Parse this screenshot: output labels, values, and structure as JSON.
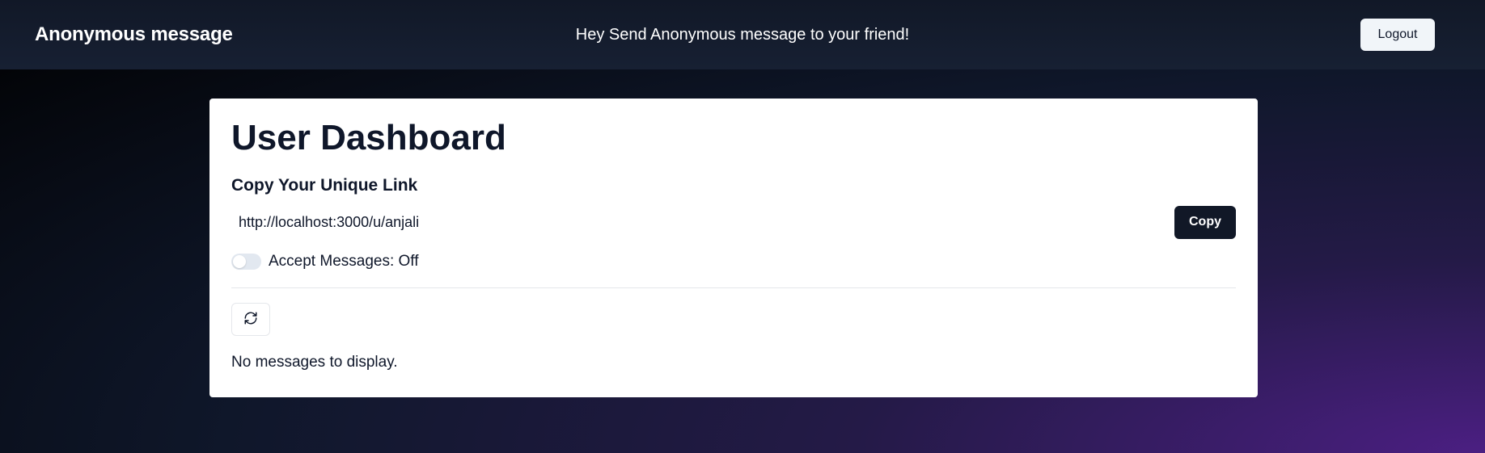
{
  "navbar": {
    "brand": "Anonymous message",
    "greeting": "Hey Send Anonymous message to your friend!",
    "logout_label": "Logout"
  },
  "dashboard": {
    "title": "User Dashboard",
    "link_heading": "Copy Your Unique Link",
    "link_value": "http://localhost:3000/u/anjali",
    "copy_label": "Copy",
    "accept_label": "Accept Messages: Off",
    "accept_enabled": false,
    "refresh_icon": "refresh-icon",
    "empty_text": "No messages to display."
  },
  "colors": {
    "primary": "#111827",
    "accent_gradient_end": "#4b1f82",
    "card_bg": "#ffffff"
  }
}
